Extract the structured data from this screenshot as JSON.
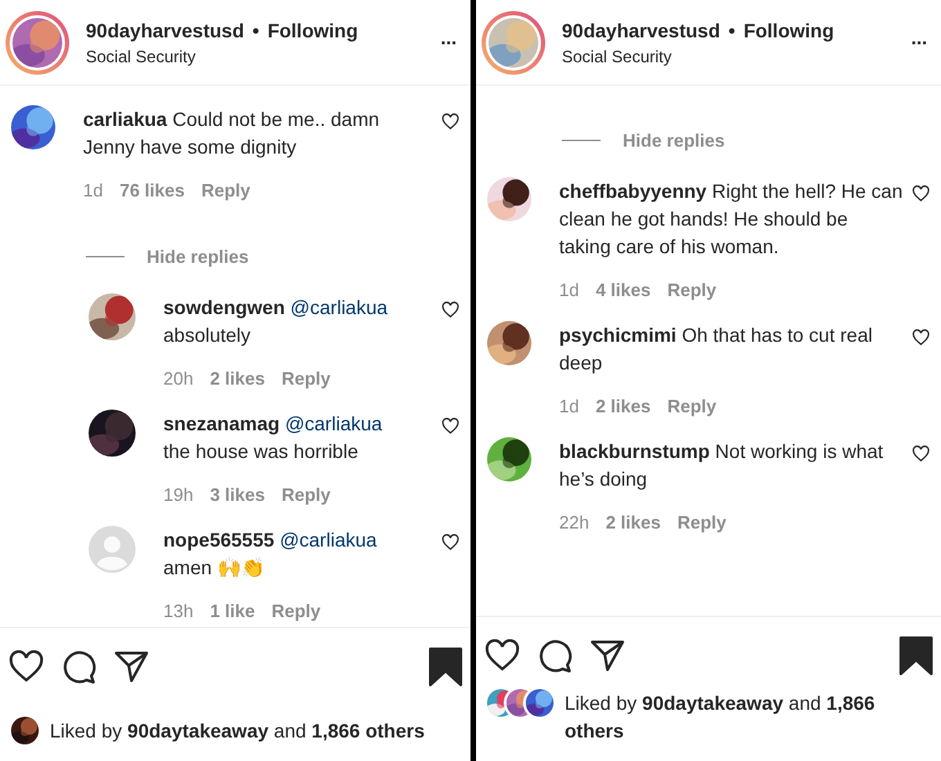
{
  "panels": [
    {
      "header": {
        "username": "90dayharvestusd",
        "separator": "•",
        "follow": "Following",
        "subtitle": "Social Security",
        "more": "..."
      },
      "feed": [
        {
          "kind": "comment",
          "username": "carliakua",
          "text": "Could not be me.. damn Jenny have some dignity",
          "time": "1d",
          "likes": "76 likes",
          "reply": "Reply"
        },
        {
          "kind": "hide_replies",
          "label": "Hide replies"
        },
        {
          "kind": "reply",
          "username": "sowdengwen",
          "mention": "@carliakua",
          "text": "absolutely",
          "time": "20h",
          "likes": "2 likes",
          "reply": "Reply"
        },
        {
          "kind": "reply",
          "username": "snezanamag",
          "mention": "@carliakua",
          "text": "the house was horrible",
          "time": "19h",
          "likes": "3 likes",
          "reply": "Reply"
        },
        {
          "kind": "reply",
          "avatar": {
            "kind": "default"
          },
          "username": "nope565555",
          "mention": "@carliakua",
          "text": "amen 🙌👏",
          "time": "13h",
          "likes": "1 like",
          "reply": "Reply"
        }
      ],
      "actions": {
        "liked": false,
        "saved": true
      },
      "liked_by": {
        "text": "Liked by **90daytakeaway** and **1,866 others**"
      }
    },
    {
      "header": {
        "username": "90dayharvestusd",
        "separator": "•",
        "follow": "Following",
        "subtitle": "Social Security",
        "more": "..."
      },
      "feed": [
        {
          "kind": "hide_replies",
          "label": "Hide replies"
        },
        {
          "kind": "comment",
          "username": "cheffbabyyenny",
          "text": "Right the hell? He can clean he got hands! He should be taking care of his woman.",
          "time": "1d",
          "likes": "4 likes",
          "reply": "Reply"
        },
        {
          "kind": "comment",
          "username": "psychicmimi",
          "text": "Oh that has to cut real deep",
          "time": "1d",
          "likes": "2 likes",
          "reply": "Reply"
        },
        {
          "kind": "comment",
          "username": "blackburnstump",
          "text": "Not working is what he’s doing",
          "time": "22h",
          "likes": "2 likes",
          "reply": "Reply"
        }
      ],
      "actions": {
        "liked": false,
        "saved": true
      },
      "liked_by": {
        "text": "Liked by **90daytakeaway** and **1,866 others**"
      }
    }
  ]
}
